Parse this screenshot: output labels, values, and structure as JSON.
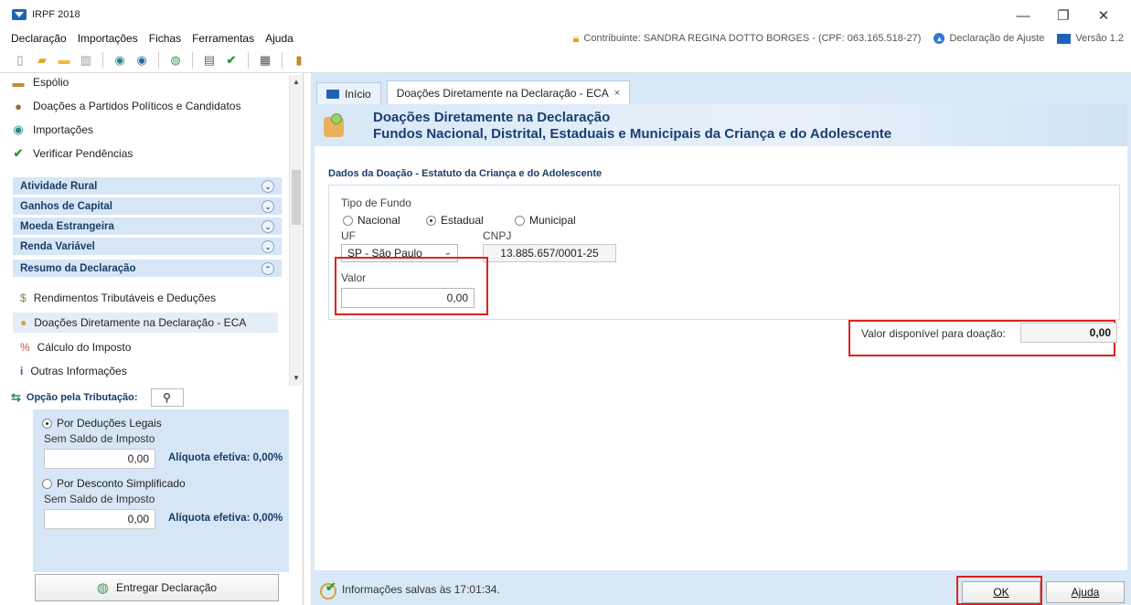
{
  "window": {
    "title": "IRPF 2018",
    "minimize": "—",
    "maximize": "❐",
    "close": "✕"
  },
  "menu": {
    "items": [
      "Declaração",
      "Importações",
      "Fichas",
      "Ferramentas",
      "Ajuda"
    ],
    "taxpayer": "Contribuinte: SANDRA REGINA DOTTO BORGES - (CPF: 063.165.518-27)",
    "declaration_type": "Declaração de Ajuste",
    "version": "Versão 1.2"
  },
  "sidebar": {
    "top_items": [
      {
        "label": "Espólio",
        "icon": "estate-icon"
      },
      {
        "label": "Doações a Partidos Políticos e Candidatos",
        "icon": "donation-bag-icon"
      },
      {
        "label": "Importações",
        "icon": "import-icon"
      },
      {
        "label": "Verificar Pendências",
        "icon": "checkmark-icon"
      }
    ],
    "sections": [
      {
        "label": "Atividade Rural",
        "expanded": false
      },
      {
        "label": "Ganhos de Capital",
        "expanded": false
      },
      {
        "label": "Moeda Estrangeira",
        "expanded": false
      },
      {
        "label": "Renda Variável",
        "expanded": false
      },
      {
        "label": "Resumo da Declaração",
        "expanded": true
      }
    ],
    "resumo_items": [
      {
        "label": "Rendimentos Tributáveis e Deduções",
        "icon": "money-icon"
      },
      {
        "label": "Doações Diretamente na Declaração - ECA",
        "icon": "children-icon",
        "active": true
      },
      {
        "label": "Cálculo do Imposto",
        "icon": "percent-icon"
      },
      {
        "label": "Outras Informações",
        "icon": "info-icon"
      }
    ]
  },
  "tax_option": {
    "header": "Opção pela Tributação:",
    "options": [
      {
        "label": "Por Deduções Legais",
        "selected": true,
        "sub": "Sem Saldo de Imposto",
        "value": "0,00",
        "rate": "Alíquota efetiva: 0,00%"
      },
      {
        "label": "Por Desconto Simplificado",
        "selected": false,
        "sub": "Sem Saldo de Imposto",
        "value": "0,00",
        "rate": "Alíquota efetiva: 0,00%"
      }
    ],
    "deliver_button": "Entregar Declaração"
  },
  "tabs": [
    {
      "label": "Início",
      "active": false
    },
    {
      "label": "Doações Diretamente na Declaração - ECA",
      "active": true,
      "close": "×"
    }
  ],
  "banner": {
    "title": "Doações Diretamente na Declaração",
    "subtitle": "Fundos Nacional, Distrital, Estaduais e Municipais da Criança e do Adolescente"
  },
  "form": {
    "group_title": "Dados da Doação - Estatuto da Criança e do Adolescente",
    "fund_type_label": "Tipo de Fundo",
    "fund_types": [
      {
        "label": "Nacional",
        "selected": false
      },
      {
        "label": "Estadual",
        "selected": true
      },
      {
        "label": "Municipal",
        "selected": false
      }
    ],
    "uf_label": "UF",
    "uf_value": "SP - São Paulo",
    "cnpj_label": "CNPJ",
    "cnpj_value": "13.885.657/0001-25",
    "valor_label": "Valor",
    "valor_value": "0,00",
    "available_label": "Valor disponível para doação:",
    "available_value": "0,00"
  },
  "status": {
    "saved_text": "Informações salvas às 17:01:34."
  },
  "buttons": {
    "ok": "OK",
    "help": "Ajuda"
  },
  "colors": {
    "accent_blue": "#1e63b8",
    "panel_blue": "#d9e8f7",
    "highlight_red": "#e02020"
  }
}
